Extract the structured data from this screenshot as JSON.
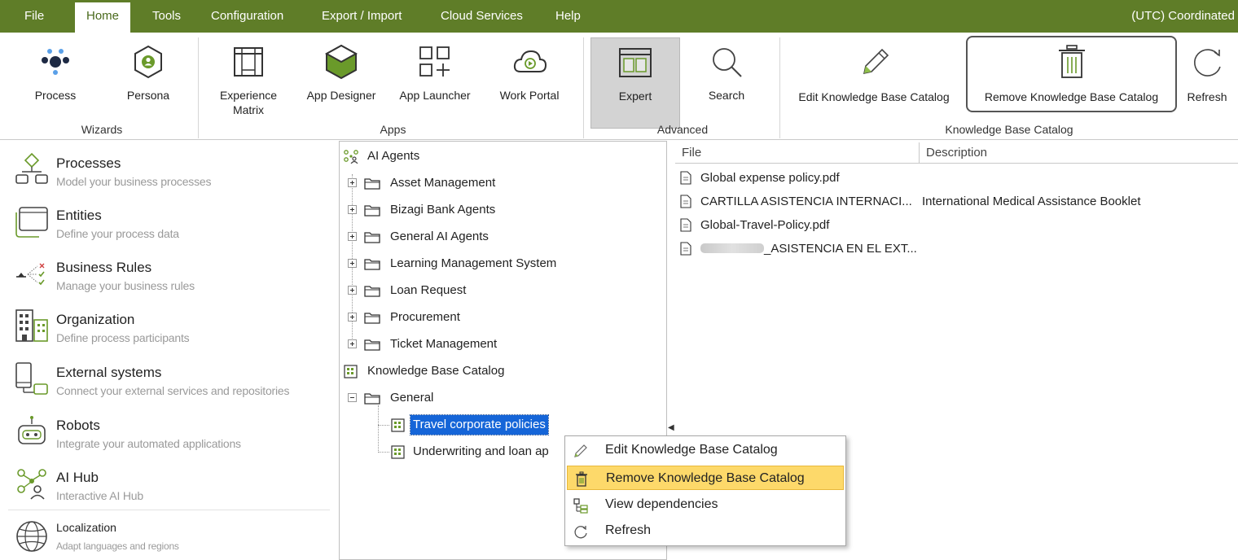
{
  "menu": {
    "items": [
      "File",
      "Home",
      "Tools",
      "Configuration",
      "Export / Import",
      "Cloud Services",
      "Help"
    ],
    "active": "Home",
    "timezone": "(UTC) Coordinated"
  },
  "ribbon": {
    "wizards": {
      "group_label": "Wizards",
      "process": "Process",
      "persona": "Persona"
    },
    "apps": {
      "group_label": "Apps",
      "experience_matrix": "Experience Matrix",
      "app_designer": "App Designer",
      "app_launcher": "App Launcher",
      "work_portal": "Work Portal"
    },
    "advanced": {
      "group_label": "Advanced",
      "expert": "Expert",
      "search": "Search"
    },
    "kb": {
      "group_label": "Knowledge Base Catalog",
      "edit": "Edit Knowledge Base Catalog",
      "remove": "Remove Knowledge Base Catalog",
      "refresh": "Refresh"
    }
  },
  "nav": [
    {
      "title": "Processes",
      "desc": "Model your business processes",
      "icon": "processes-icon"
    },
    {
      "title": "Entities",
      "desc": "Define your process data",
      "icon": "entities-icon"
    },
    {
      "title": "Business Rules",
      "desc": "Manage your business rules",
      "icon": "business-rules-icon"
    },
    {
      "title": "Organization",
      "desc": "Define process participants",
      "icon": "organization-icon"
    },
    {
      "title": "External systems",
      "desc": "Connect your external services and repositories",
      "icon": "external-systems-icon"
    },
    {
      "title": "Robots",
      "desc": "Integrate your automated applications",
      "icon": "robot-icon"
    },
    {
      "title": "AI Hub",
      "desc": "Interactive AI Hub",
      "icon": "ai-hub-icon"
    },
    {
      "title": "Localization",
      "desc": "Adapt languages and regions",
      "icon": "globe-icon"
    }
  ],
  "tree": {
    "root": "AI Agents",
    "agents": [
      "Asset Management",
      "Bizagi Bank Agents",
      "General AI Agents",
      "Learning Management System",
      "Loan Request",
      "Procurement",
      "Ticket Management"
    ],
    "kb_root": "Knowledge Base Catalog",
    "kb_folder": "General",
    "kb_items": [
      "Travel corporate policies",
      "Underwriting and loan ap"
    ],
    "selected": "Travel corporate policies"
  },
  "files": {
    "headers": {
      "file": "File",
      "description": "Description"
    },
    "rows": [
      {
        "name": "Global expense policy.pdf",
        "desc": ""
      },
      {
        "name": "CARTILLA ASISTENCIA INTERNACI...",
        "desc": "International Medical Assistance Booklet"
      },
      {
        "name": "Global-Travel-Policy.pdf",
        "desc": ""
      },
      {
        "name": "_ASISTENCIA EN EL EXT...",
        "desc": ""
      }
    ]
  },
  "context_menu": {
    "items": [
      {
        "label": "Edit Knowledge Base Catalog",
        "icon": "pencil-icon"
      },
      {
        "label": "Remove Knowledge Base Catalog",
        "icon": "trash-icon",
        "highlighted": true
      },
      {
        "label": "View dependencies",
        "icon": "dependencies-icon"
      },
      {
        "label": "Refresh",
        "icon": "refresh-icon"
      }
    ]
  },
  "colors": {
    "menubar": "#5f7d28",
    "selection": "#1565d8",
    "highlight": "#fdd96a",
    "accent_green": "#6a9a2a"
  }
}
